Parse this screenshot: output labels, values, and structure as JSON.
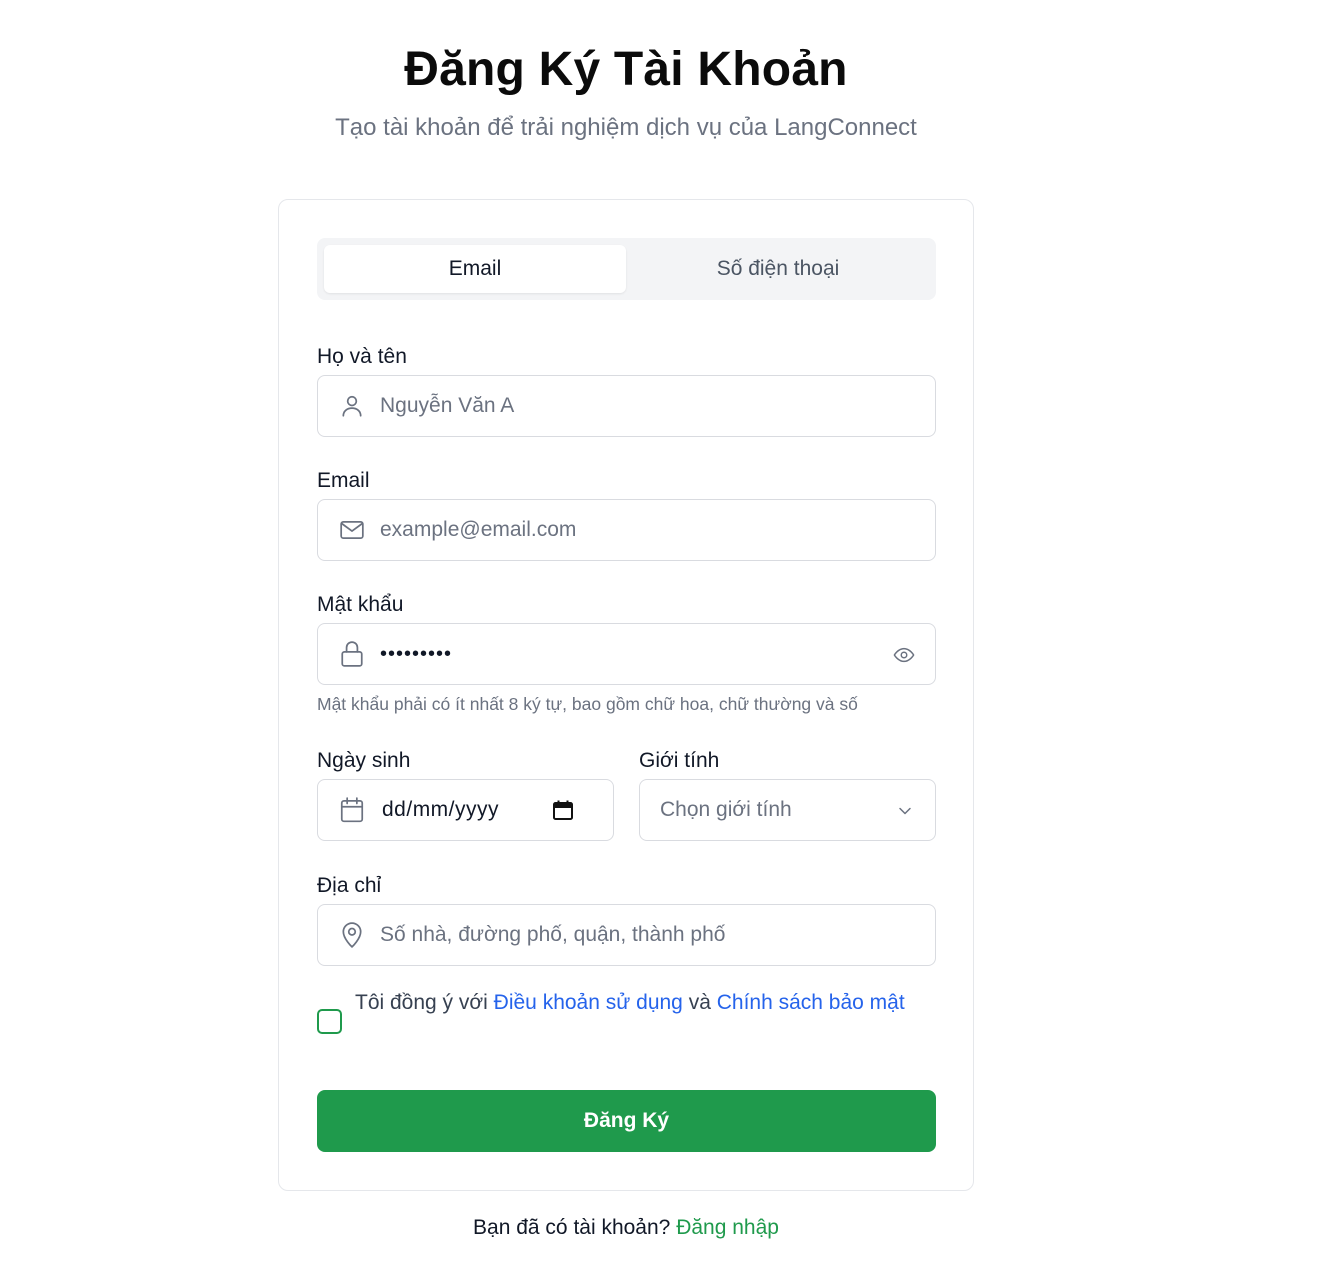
{
  "header": {
    "title": "Đăng Ký Tài Khoản",
    "subtitle": "Tạo tài khoản để trải nghiệm dịch vụ của LangConnect"
  },
  "tabs": [
    {
      "label": "Email",
      "active": true
    },
    {
      "label": "Số điện thoại",
      "active": false
    }
  ],
  "form": {
    "full_name": {
      "label": "Họ và tên",
      "placeholder": "Nguyễn Văn A",
      "icon": "user-icon"
    },
    "email": {
      "label": "Email",
      "placeholder": "example@email.com",
      "icon": "mail-icon"
    },
    "password": {
      "label": "Mật khẩu",
      "value": "•••••••••",
      "icon": "lock-icon",
      "toggle_icon": "eye-icon",
      "hint": "Mật khẩu phải có ít nhất 8 ký tự, bao gồm chữ hoa, chữ thường và số"
    },
    "birthday": {
      "label": "Ngày sinh",
      "value": "dd/mm/yyyy",
      "icon": "calendar-icon",
      "picker_icon": "calendar-picker-icon"
    },
    "gender": {
      "label": "Giới tính",
      "placeholder": "Chọn giới tính",
      "icon": "chevron-down-icon"
    },
    "address": {
      "label": "Địa chỉ",
      "placeholder": "Số nhà, đường phố, quận, thành phố",
      "icon": "map-pin-icon"
    },
    "terms": {
      "prefix": "Tôi đồng ý với ",
      "terms_link": "Điều khoản sử dụng",
      "middle": " và ",
      "privacy_link": "Chính sách bảo mật",
      "checked": false
    },
    "submit_label": "Đăng Ký"
  },
  "footer": {
    "text": "Bạn đã có tài khoản? ",
    "login_link": "Đăng nhập"
  },
  "colors": {
    "primary": "#1f9a4c",
    "link": "#2563eb",
    "muted": "#6b7280",
    "border": "#d9dbe0"
  }
}
